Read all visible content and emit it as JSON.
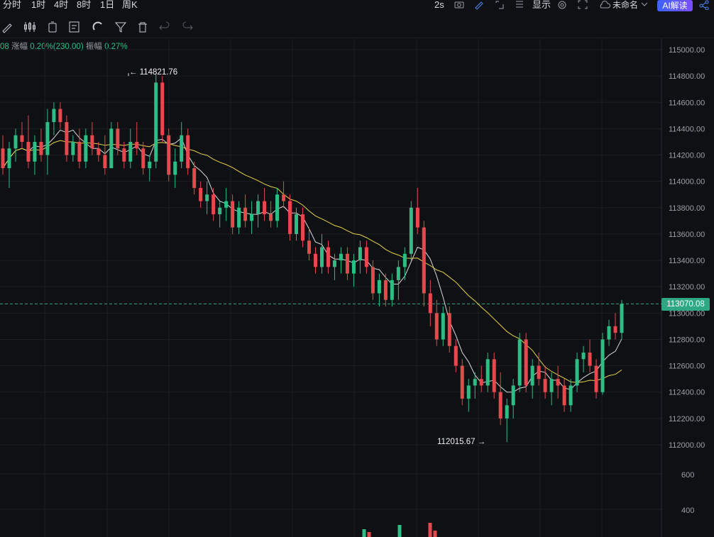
{
  "timeframes": [
    "分时",
    "1时",
    "4时",
    "8时",
    "1日",
    "周K"
  ],
  "topbar": {
    "interval": "2s",
    "display_label": "显示",
    "layout_name": "未命名",
    "ai_label": "AI解读"
  },
  "stats": {
    "change_label": "涨幅",
    "change_value": "0.20%(230.00)",
    "amplitude_label": "振幅",
    "amplitude_value": "0.27%",
    "leading": "08"
  },
  "annotations": {
    "high": "← 114821.76",
    "low": "112015.67 →"
  },
  "current_price": "113070.08",
  "colors": {
    "up": "#2ebd85",
    "down": "#e5484d",
    "ma_fast": "#d9d9d9",
    "ma_slow": "#e6d24a",
    "price_tag": "#2ea883"
  },
  "chart_data": {
    "type": "candlestick",
    "y_axis_ticks": [
      "115000.00",
      "114800.00",
      "114600.00",
      "114400.00",
      "114200.00",
      "114000.00",
      "113800.00",
      "113600.00",
      "113400.00",
      "113200.00",
      "113000.00",
      "112800.00",
      "112600.00",
      "112400.00",
      "112200.00",
      "112000.00"
    ],
    "ylim": [
      111800,
      115150
    ],
    "volume_ticks": [
      "600",
      "400"
    ],
    "high_marker": 114821.76,
    "low_marker": 112015.67,
    "last_price": 113070.08,
    "candles": [
      [
        114250,
        114350,
        114050,
        114100
      ],
      [
        114100,
        114300,
        113950,
        114250
      ],
      [
        114250,
        114400,
        114150,
        114350
      ],
      [
        114350,
        114450,
        114250,
        114300
      ],
      [
        114300,
        114500,
        114100,
        114150
      ],
      [
        114150,
        114350,
        114050,
        114300
      ],
      [
        114300,
        114400,
        114150,
        114200
      ],
      [
        114200,
        114550,
        114050,
        114450
      ],
      [
        114450,
        114600,
        114350,
        114550
      ],
      [
        114550,
        114600,
        114400,
        114450
      ],
      [
        114450,
        114500,
        114150,
        114200
      ],
      [
        114200,
        114350,
        114150,
        114300
      ],
      [
        114300,
        114400,
        114100,
        114150
      ],
      [
        114150,
        114400,
        114100,
        114350
      ],
      [
        114350,
        114450,
        114200,
        114250
      ],
      [
        114250,
        114300,
        114150,
        114200
      ],
      [
        114200,
        114350,
        114050,
        114100
      ],
      [
        114100,
        114450,
        114100,
        114400
      ],
      [
        114400,
        114450,
        114200,
        114250
      ],
      [
        114250,
        114300,
        114100,
        114150
      ],
      [
        114150,
        114400,
        114100,
        114300
      ],
      [
        114300,
        114450,
        114200,
        114250
      ],
      [
        114250,
        114300,
        114050,
        114100
      ],
      [
        114100,
        114200,
        114000,
        114150
      ],
      [
        114150,
        114820,
        114100,
        114750
      ],
      [
        114750,
        114800,
        114300,
        114350
      ],
      [
        114350,
        114400,
        114000,
        114050
      ],
      [
        114050,
        114250,
        113950,
        114150
      ],
      [
        114150,
        114450,
        114100,
        114350
      ],
      [
        114350,
        114400,
        114050,
        114100
      ],
      [
        114100,
        114150,
        113900,
        113950
      ],
      [
        113950,
        114000,
        113800,
        113850
      ],
      [
        113850,
        114000,
        113750,
        113900
      ],
      [
        113900,
        113950,
        113700,
        113750
      ],
      [
        113750,
        113850,
        113650,
        113800
      ],
      [
        113800,
        113950,
        113700,
        113850
      ],
      [
        113850,
        113900,
        113600,
        113650
      ],
      [
        113650,
        113850,
        113600,
        113800
      ],
      [
        113800,
        113900,
        113650,
        113700
      ],
      [
        113700,
        113850,
        113600,
        113750
      ],
      [
        113750,
        113900,
        113650,
        113850
      ],
      [
        113850,
        113950,
        113700,
        113750
      ],
      [
        113750,
        113850,
        113650,
        113700
      ],
      [
        113700,
        113950,
        113650,
        113900
      ],
      [
        113900,
        114000,
        113800,
        113850
      ],
      [
        113850,
        113900,
        113550,
        113600
      ],
      [
        113600,
        113800,
        113550,
        113750
      ],
      [
        113750,
        113800,
        113500,
        113550
      ],
      [
        113550,
        113650,
        113400,
        113450
      ],
      [
        113450,
        113500,
        113300,
        113350
      ],
      [
        113350,
        113600,
        113300,
        113500
      ],
      [
        113500,
        113550,
        113300,
        113350
      ],
      [
        113350,
        113450,
        113250,
        113400
      ],
      [
        113400,
        113500,
        113300,
        113450
      ],
      [
        113450,
        113500,
        113250,
        113300
      ],
      [
        113300,
        113450,
        113200,
        113400
      ],
      [
        113400,
        113550,
        113300,
        113500
      ],
      [
        113500,
        113550,
        113300,
        113350
      ],
      [
        113350,
        113400,
        113100,
        113150
      ],
      [
        113150,
        113300,
        113050,
        113250
      ],
      [
        113250,
        113300,
        113050,
        113100
      ],
      [
        113100,
        113300,
        113050,
        113250
      ],
      [
        113250,
        113400,
        113100,
        113350
      ],
      [
        113350,
        113500,
        113250,
        113450
      ],
      [
        113450,
        113850,
        113400,
        113800
      ],
      [
        113800,
        113950,
        113600,
        113650
      ],
      [
        113650,
        113700,
        113050,
        113150
      ],
      [
        113150,
        113250,
        112900,
        113000
      ],
      [
        113000,
        113100,
        112750,
        112800
      ],
      [
        112800,
        113050,
        112750,
        113000
      ],
      [
        113000,
        113050,
        112700,
        112750
      ],
      [
        112750,
        112800,
        112550,
        112600
      ],
      [
        112600,
        112650,
        112300,
        112350
      ],
      [
        112350,
        112500,
        112250,
        112450
      ],
      [
        112450,
        112550,
        112350,
        112500
      ],
      [
        112500,
        112600,
        112400,
        112450
      ],
      [
        112450,
        112700,
        112400,
        112650
      ],
      [
        112650,
        112700,
        112350,
        112400
      ],
      [
        112400,
        112550,
        112150,
        112200
      ],
      [
        112200,
        112350,
        112020,
        112300
      ],
      [
        112300,
        112500,
        112200,
        112450
      ],
      [
        112450,
        112850,
        112400,
        112800
      ],
      [
        112800,
        112850,
        112400,
        112450
      ],
      [
        112450,
        112650,
        112350,
        112600
      ],
      [
        112600,
        112700,
        112450,
        112500
      ],
      [
        112500,
        112600,
        112350,
        112400
      ],
      [
        112400,
        112550,
        112300,
        112500
      ],
      [
        112500,
        112600,
        112350,
        112450
      ],
      [
        112450,
        112500,
        112250,
        112300
      ],
      [
        112300,
        112500,
        112250,
        112450
      ],
      [
        112450,
        112700,
        112400,
        112650
      ],
      [
        112650,
        112750,
        112550,
        112700
      ],
      [
        112700,
        112800,
        112550,
        112600
      ],
      [
        112600,
        112650,
        112350,
        112400
      ],
      [
        112400,
        112850,
        112380,
        112800
      ],
      [
        112800,
        112950,
        112750,
        112900
      ],
      [
        112900,
        113000,
        112800,
        112850
      ],
      [
        112850,
        113100,
        112800,
        113070
      ]
    ]
  }
}
